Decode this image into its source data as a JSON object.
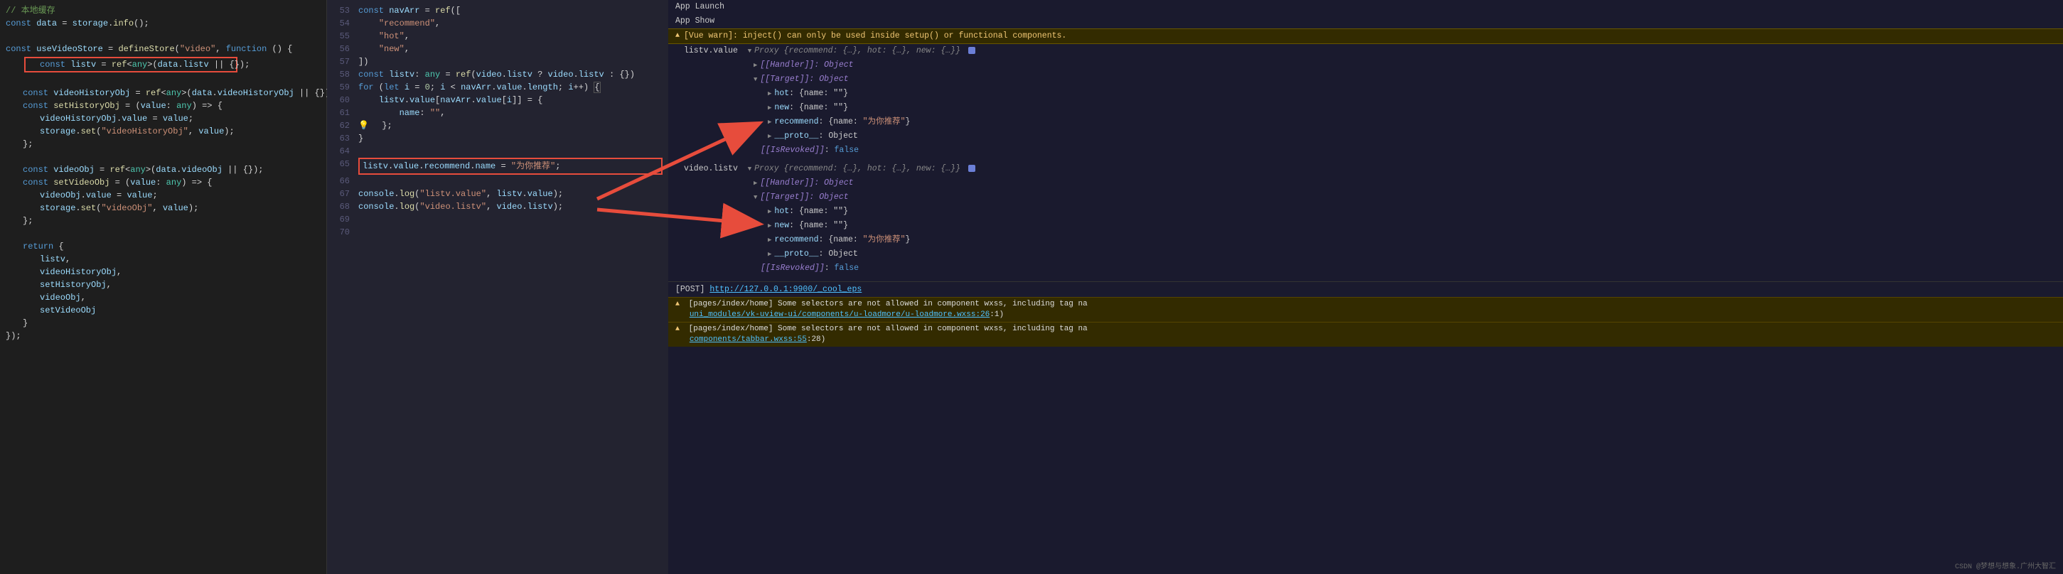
{
  "left": {
    "comment": "// 本地缓存",
    "l1": "const data = storage.info();",
    "l3": "const useVideoStore = defineStore(\"video\", function () {",
    "l5": "const listv = ref<any>(data.listv || {});",
    "l7": "const videoHistoryObj = ref<any>(data.videoHistoryObj || {});",
    "l8": "const setHistoryObj = (value: any) => {",
    "l9": "videoHistoryObj.value = value;",
    "l10": "storage.set(\"videoHistoryObj\", value);",
    "l11": "};",
    "l13": "const videoObj = ref<any>(data.videoObj || {});",
    "l14": "const setVideoObj = (value: any) => {",
    "l15": "videoObj.value = value;",
    "l16": "storage.set(\"videoObj\", value);",
    "l17": "};",
    "l19": "return {",
    "l20": "listv,",
    "l21": "videoHistoryObj,",
    "l22": "setHistoryObj,",
    "l23": "videoObj,",
    "l24": "setVideoObj",
    "l25": "}",
    "l26": "});"
  },
  "mid": {
    "lines": {
      "53": "const navArr = ref([",
      "54": "    \"recommend\",",
      "55": "    \"hot\",",
      "56": "    \"new\",",
      "57": "])",
      "58": "const listv: any = ref(video.listv ? video.listv : {})",
      "59": "for (let i = 0; i < navArr.value.length; i++) {",
      "60": "    listv.value[navArr.value[i]] = {",
      "61": "        name: \"\",",
      "62": "    };",
      "63": "}",
      "64": "",
      "65": "listv.value.recommend.name = \"为你推荐\";",
      "66": "",
      "67": "console.log(\"listv.value\", listv.value);",
      "68": "console.log(\"video.listv\", video.listv);",
      "69": "",
      "70": ""
    }
  },
  "right": {
    "header1": "App Launch",
    "header2": "App Show",
    "vuewarn": "[Vue warn]: inject() can only be used inside setup() or functional components.",
    "log1_label": "listv.value",
    "log2_label": "video.listv",
    "proxy_summary": "Proxy {recommend: {…}, hot: {…}, new: {…}}",
    "handler": "[[Handler]]: Object",
    "target": "[[Target]]: Object",
    "hot": "hot: {name: \"\"}",
    "new": "new: {name: \"\"}",
    "recommend": "recommend: {name: \"为你推荐\"}",
    "proto": "__proto__: Object",
    "revoked": "[[IsRevoked]]: false",
    "post": "[POST] http://127.0.0.1:9900/_cool_eps",
    "post_url": "http://127.0.0.1:9900/_cool_eps",
    "warn1": "[pages/index/home] Some selectors are not allowed in component wxss, including tag na",
    "warn1_link": "uni_modules/vk-uview-ui/components/u-loadmore/u-loadmore.wxss:26",
    "warn1_suffix": ":1)",
    "warn2": "[pages/index/home] Some selectors are not allowed in component wxss, including tag na",
    "warn2_link": "components/tabbar.wxss:55",
    "warn2_suffix": ":28)"
  },
  "watermark": "CSDN @梦想与想象.广州大智汇"
}
